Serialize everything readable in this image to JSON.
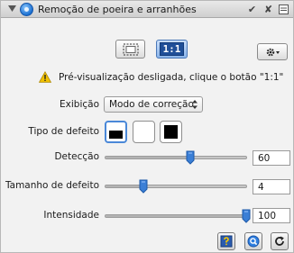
{
  "titlebar": {
    "title": "Remoção de poeira e arranhões",
    "check_label": "✔",
    "close_label": "✘"
  },
  "preview": {
    "fit_button": "fit-frame",
    "one_to_one_label": "1:1"
  },
  "warning": {
    "text": "Pré-visualização desligada, clique o botão \"1:1\""
  },
  "exibicao": {
    "label": "Exibição",
    "value": "Modo de correção"
  },
  "tipo_defeito": {
    "label": "Tipo de defeito",
    "options": [
      "half-black",
      "white",
      "black"
    ],
    "selected": 0
  },
  "sliders": [
    {
      "label": "Detecção",
      "value": "60",
      "fraction": 0.6
    },
    {
      "label": "Tamanho de defeito",
      "value": "4",
      "fraction": 0.27
    },
    {
      "label": "Intensidade",
      "value": "100",
      "fraction": 1.0
    }
  ],
  "colors": {
    "accent": "#4a88d8",
    "thumb": "#3b7fd6",
    "warning": "#f2c200"
  },
  "bottom_buttons": [
    "help-icon",
    "preview-icon",
    "reset-icon"
  ]
}
